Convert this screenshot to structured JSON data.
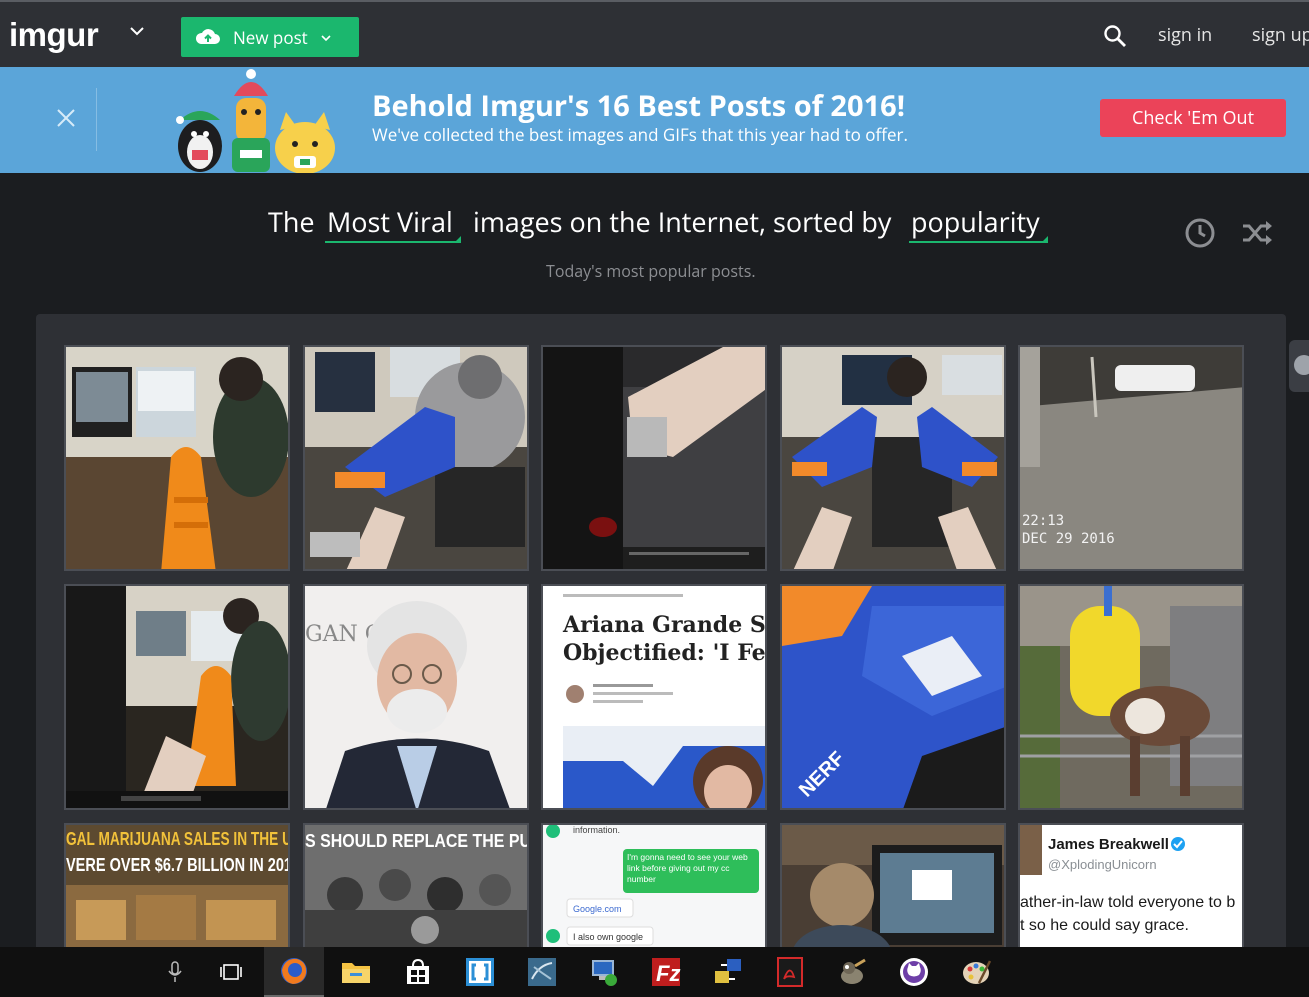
{
  "nav": {
    "logo": "imgur",
    "new_post": "New post",
    "sign_in": "sign in",
    "sign_up": "sign up",
    "icons": [
      "chevron-down-icon",
      "cloud-upload-icon",
      "search-icon"
    ]
  },
  "banner": {
    "title": "Behold Imgur's 16 Best Posts of 2016!",
    "subtitle": "We've collected the best images and GIFs that this year had to offer.",
    "cta": "Check 'Em Out",
    "color": "#5ba5d9",
    "cta_color": "#eb4359"
  },
  "heading": {
    "prefix": "The",
    "section": "Most Viral",
    "middle": "images on the Internet, sorted by",
    "sort": "popularity",
    "tagline": "Today's most popular posts.",
    "accent": "#1bb76e"
  },
  "gallery": {
    "thumbnails": [
      {
        "subject": "person holding orange toy blaster at desk"
      },
      {
        "subject": "hand holding blue Nerf blaster behind coworker"
      },
      {
        "subject": "hand reaching into dark space"
      },
      {
        "subject": "two blue Nerf blasters aimed at coworker"
      },
      {
        "subject": "night security camera street view",
        "text_lines": [
          "22:13",
          "DEC 29 2016"
        ]
      },
      {
        "subject": "orange toy blaster aimed at coworker"
      },
      {
        "subject": "portrait of white-haired man with glasses",
        "text_lines": [
          "GAN C"
        ]
      },
      {
        "subject": "article screenshot",
        "text_lines": [
          "Ariana Grande Sl",
          "Objectified: 'I Fel"
        ]
      },
      {
        "subject": "close-up blue Nerf blaster",
        "text_lines": [
          "NERF"
        ]
      },
      {
        "subject": "cow with yellow rotating brush"
      },
      {
        "subject": "store shelves meme",
        "text_lines": [
          "GAL MARIJUANA SALES IN THE U",
          "VERE OVER $6.7 BILLION IN 201"
        ]
      },
      {
        "subject": "black and white crowd meme",
        "text_lines": [
          "S SHOULD REPLACE THE PU"
        ]
      },
      {
        "subject": "chat screenshot",
        "text_lines": [
          "information.",
          "I'm gonna need to see your web link before giving out my cc number",
          "Google.com",
          "I also own google"
        ]
      },
      {
        "subject": "person at computer monitor"
      },
      {
        "subject": "tweet screenshot",
        "text_lines": [
          "James Breakwell",
          "@XplodingUnicorn",
          "ather-in-law told everyone to b",
          "t so he could say grace."
        ]
      }
    ]
  },
  "taskbar": {
    "items": [
      "microphone-icon",
      "task-view-icon",
      "firefox-icon",
      "file-explorer-icon",
      "store-icon",
      "brackets-icon",
      "sql-icon",
      "network-icon",
      "filezilla-icon",
      "transfer-icon",
      "pdf-icon",
      "gimp-icon",
      "github-icon",
      "paint-icon"
    ]
  }
}
